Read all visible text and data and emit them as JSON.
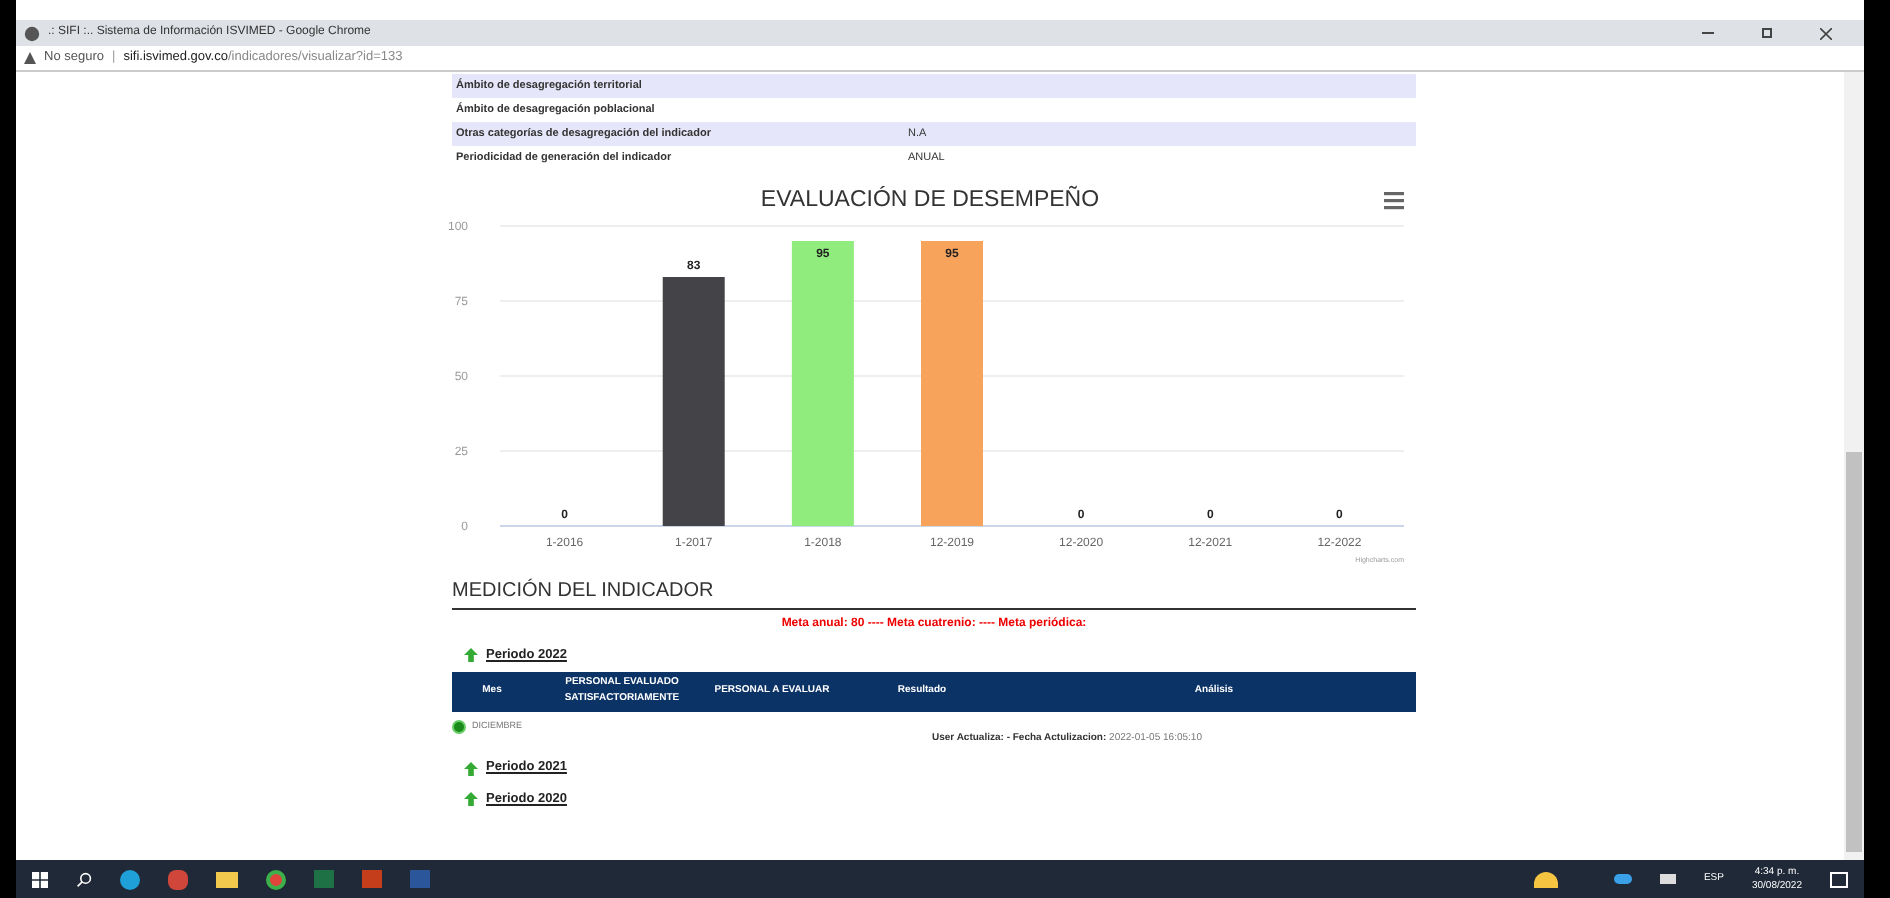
{
  "window": {
    "title": ".: SIFI :.. Sistema de Información ISVIMED - Google Chrome"
  },
  "address_bar": {
    "security": "No seguro",
    "separator": "|",
    "domain": "sifi.isvimed.gov.co",
    "path": "/indicadores/visualizar?id=133"
  },
  "details": [
    {
      "label": "Ámbito de desagregación territorial",
      "shaded": true
    },
    {
      "label": "Ámbito de desagregación poblacional",
      "shaded": false
    },
    {
      "label": "Otras categorías de desagregación del indicador",
      "value": "N.A",
      "shaded": true
    },
    {
      "label": "Periodicidad de generación del indicador",
      "value": "ANUAL",
      "shaded": false
    }
  ],
  "chart": {
    "credit": "Highcharts.com",
    "chart_data": {
      "type": "bar",
      "title": "EVALUACIÓN DE DESEMPEÑO",
      "categories": [
        "1-2016",
        "1-2017",
        "1-2018",
        "12-2019",
        "12-2020",
        "12-2021",
        "12-2022"
      ],
      "series": [
        {
          "color": "#434348",
          "values": [
            0,
            83,
            null,
            null,
            0,
            0,
            0
          ]
        },
        {
          "color": "#90ed7d",
          "values": [
            null,
            null,
            95,
            null,
            null,
            null,
            null
          ]
        },
        {
          "color": "#f7a35c",
          "values": [
            null,
            null,
            null,
            95,
            null,
            null,
            null
          ]
        }
      ],
      "ylim": [
        0,
        100
      ],
      "yticks": [
        0,
        25,
        50,
        75,
        100
      ],
      "grid": true,
      "data_labels": true
    }
  },
  "measurement": {
    "heading": "MEDICIÓN DEL INDICADOR",
    "goals": "Meta anual: 80 ---- Meta cuatrenio: ---- Meta periódica:",
    "periods": [
      {
        "label": "Periodo 2022",
        "expanded": true,
        "columns": [
          "Mes",
          "PERSONAL EVALUADO SATISFACTORIAMENTE",
          "PERSONAL A EVALUAR",
          "Resultado",
          "Análisis"
        ],
        "rows": [
          {
            "month": "DICIEMBRE",
            "update_label": "User Actualiza: - Fecha Actulizacion:",
            "update_date": "2022-01-05 16:05:10"
          }
        ]
      },
      {
        "label": "Periodo 2021",
        "expanded": false
      },
      {
        "label": "Periodo 2020",
        "expanded": false
      }
    ]
  },
  "taskbar": {
    "time": "4:34 p. m.",
    "date": "30/08/2022",
    "language": "ESP"
  }
}
